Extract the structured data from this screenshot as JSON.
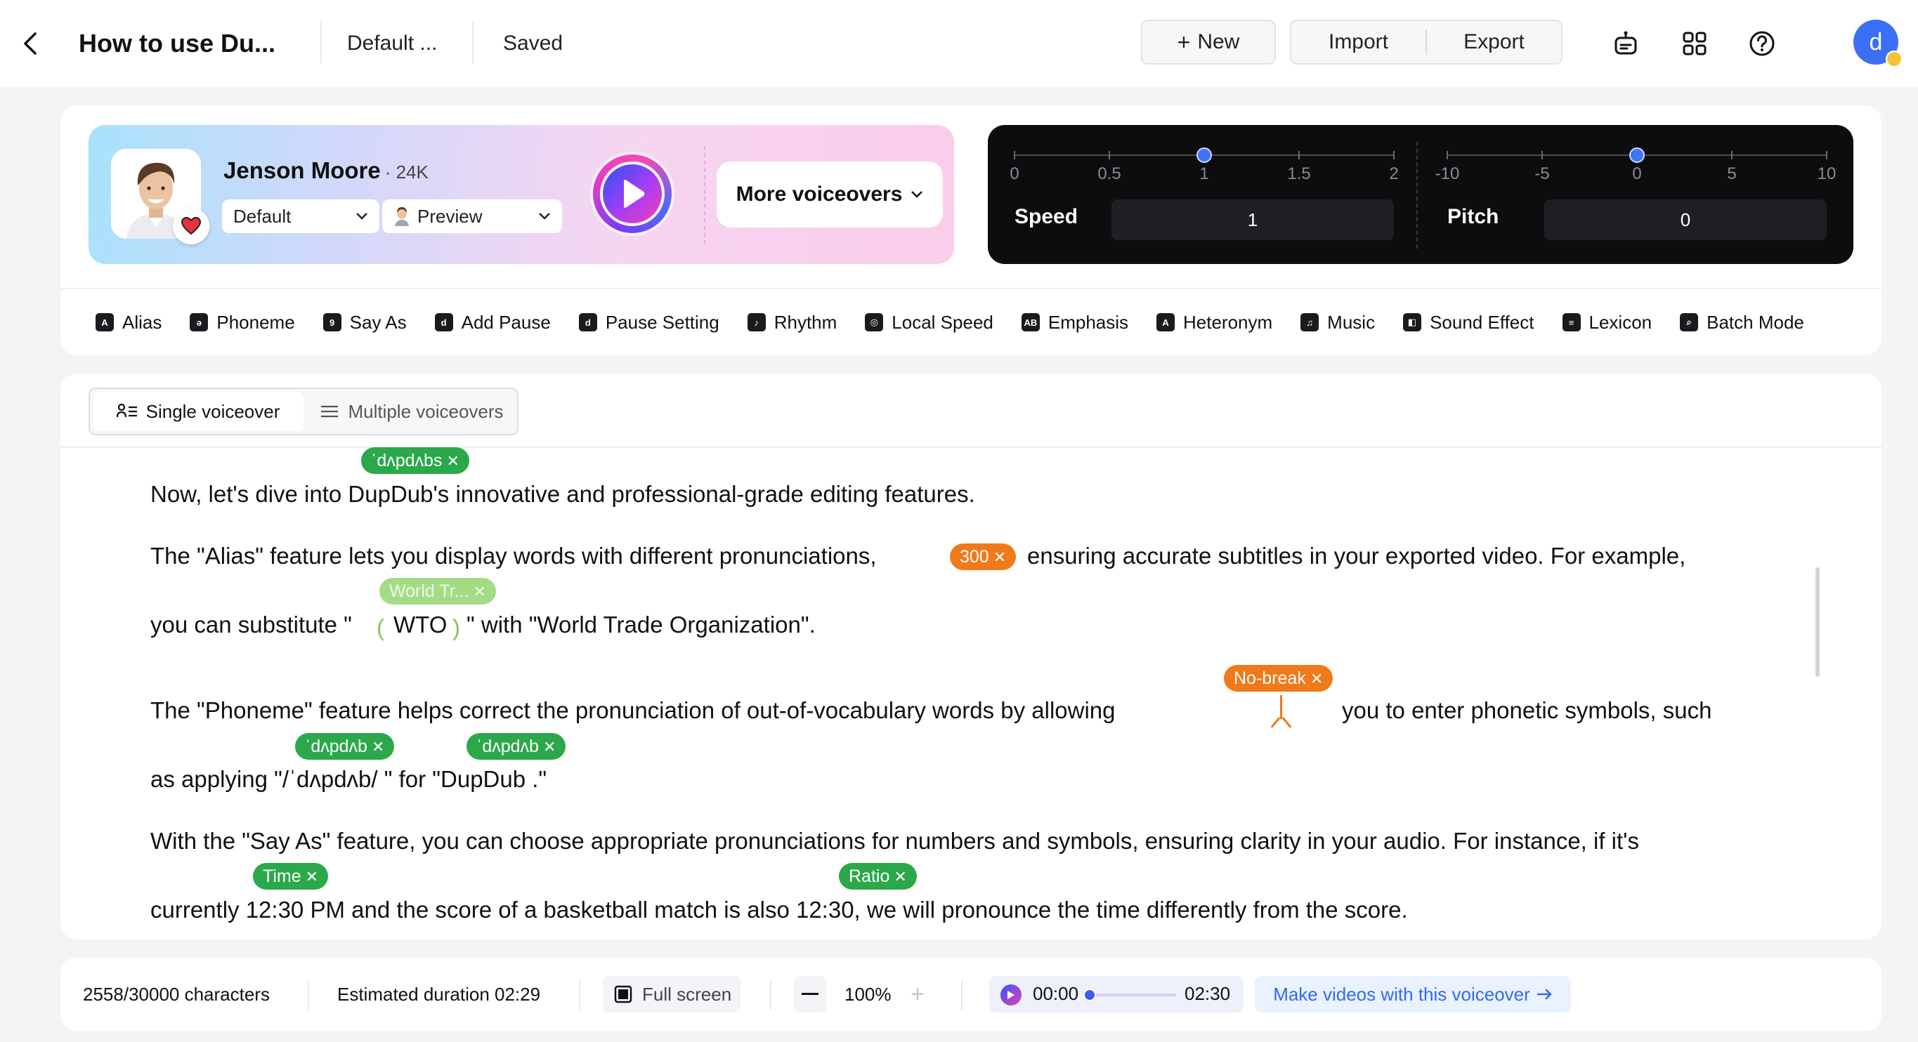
{
  "topbar": {
    "title": "How to use Du...",
    "preset": "Default ...",
    "status": "Saved",
    "new_label": "New",
    "import_label": "Import",
    "export_label": "Export",
    "user_initial": "d"
  },
  "voice": {
    "name": "Jenson Moore",
    "count": "· 24K",
    "style": "Default",
    "preview": "Preview",
    "more_label": "More voiceovers"
  },
  "speed": {
    "label": "Speed",
    "value": "1",
    "ticks": [
      "0",
      "0.5",
      "1",
      "1.5",
      "2"
    ],
    "position": 0.5
  },
  "pitch": {
    "label": "Pitch",
    "value": "0",
    "ticks": [
      "-10",
      "-5",
      "0",
      "5",
      "10"
    ],
    "position": 0.5
  },
  "toolbar": {
    "items": [
      {
        "label": "Alias",
        "icon": "A"
      },
      {
        "label": "Phoneme",
        "icon": "ə"
      },
      {
        "label": "Say As",
        "icon": "9"
      },
      {
        "label": "Add Pause",
        "icon": "d"
      },
      {
        "label": "Pause Setting",
        "icon": "d"
      },
      {
        "label": "Rhythm",
        "icon": "♪"
      },
      {
        "label": "Local Speed",
        "icon": "◎"
      },
      {
        "label": "Emphasis",
        "icon": "AB"
      },
      {
        "label": "Heteronym",
        "icon": "A"
      },
      {
        "label": "Music",
        "icon": "♫"
      },
      {
        "label": "Sound Effect",
        "icon": "◧"
      },
      {
        "label": "Lexicon",
        "icon": "≡"
      },
      {
        "label": "Batch Mode",
        "icon": "⌕"
      }
    ]
  },
  "editor": {
    "mode_single": "Single voiceover",
    "mode_multiple": "Multiple voiceovers",
    "lines": {
      "l1": "Now, let's dive into DupDub's  innovative and professional-grade editing features.",
      "l2a": "The \"Alias\" feature lets you display words with different pronunciations,",
      "l2b": "ensuring accurate subtitles in your exported video. For example,",
      "l3a": "you can substitute \"",
      "l3b": "WTO",
      "l3c": "\" with \"World Trade Organization\".",
      "l4a": "The \"Phoneme\" feature helps correct the pronunciation of out-of-vocabulary words by allowing",
      "l4b": "you to enter phonetic symbols, such",
      "l5": "as applying \"/ˈdʌpdʌb/ \" for \"DupDub .\"",
      "l6": "With the \"Say As\" feature, you can choose appropriate pronunciations for numbers and symbols, ensuring clarity in your audio. For instance, if it's",
      "l7": "currently 12:30 PM and the score of a basketball match is also 12:30, we will pronounce the time differently from the score."
    },
    "tags": {
      "t1": "ˈdʌpdʌbs",
      "t2": "300",
      "t3": "World Tr...",
      "t4": "No-break",
      "t5": "ˈdʌpdʌb",
      "t6": "ˈdʌpdʌb",
      "t7": "Time",
      "t8": "Ratio"
    }
  },
  "footer": {
    "chars": "2558/30000 characters",
    "duration": "Estimated duration 02:29",
    "fullscreen": "Full screen",
    "zoom": "100%",
    "time_start": "00:00",
    "time_end": "02:30",
    "make_video": "Make videos with this voiceover"
  }
}
